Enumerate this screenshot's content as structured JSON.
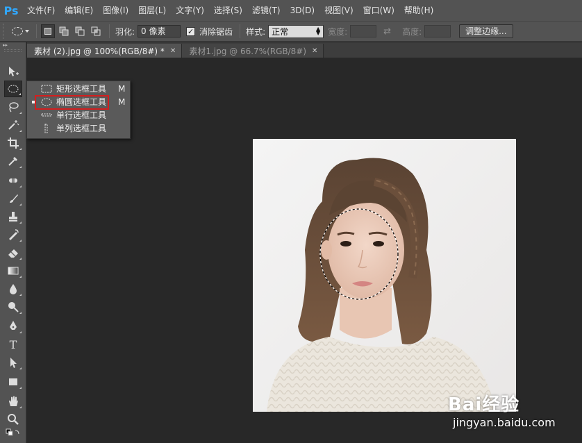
{
  "app": {
    "logo": "Ps"
  },
  "menu": [
    {
      "label": "文件(F)"
    },
    {
      "label": "编辑(E)"
    },
    {
      "label": "图像(I)"
    },
    {
      "label": "图层(L)"
    },
    {
      "label": "文字(Y)"
    },
    {
      "label": "选择(S)"
    },
    {
      "label": "滤镜(T)"
    },
    {
      "label": "3D(D)"
    },
    {
      "label": "视图(V)"
    },
    {
      "label": "窗口(W)"
    },
    {
      "label": "帮助(H)"
    }
  ],
  "options": {
    "tool_icon": "ellipse-marquee-icon",
    "feather_label": "羽化:",
    "feather_value": "0 像素",
    "antialias_label": "消除锯齿",
    "antialias_checked": true,
    "style_label": "样式:",
    "style_value": "正常",
    "width_label": "宽度:",
    "height_label": "高度:",
    "refine_label": "调整边缘..."
  },
  "tabs": [
    {
      "label": "素材 (2).jpg @ 100%(RGB/8#) *",
      "active": true
    },
    {
      "label": "素材1.jpg @ 66.7%(RGB/8#)",
      "active": false
    }
  ],
  "flyout": {
    "items": [
      {
        "label": "矩形选框工具",
        "shortcut": "M",
        "icon": "rect-marquee-icon"
      },
      {
        "label": "椭圆选框工具",
        "shortcut": "M",
        "icon": "ellipse-marquee-icon",
        "current": true
      },
      {
        "label": "单行选框工具",
        "shortcut": "",
        "icon": "single-row-marquee-icon"
      },
      {
        "label": "单列选框工具",
        "shortcut": "",
        "icon": "single-column-marquee-icon"
      }
    ],
    "highlight_color": "#d41e1e"
  },
  "tools": [
    "move-tool",
    "ellipse-marquee-tool",
    "lasso-tool",
    "magic-wand-tool",
    "crop-tool",
    "eyedropper-tool",
    "spot-healing-tool",
    "brush-tool",
    "clone-stamp-tool",
    "history-brush-tool",
    "eraser-tool",
    "gradient-tool",
    "blur-tool",
    "dodge-tool",
    "pen-tool",
    "type-tool",
    "path-selection-tool",
    "shape-tool",
    "hand-tool",
    "zoom-tool"
  ],
  "type_tool_glyph": "T",
  "colors": {
    "accent": "#31a8ff",
    "panel": "#535353",
    "canvas_bg": "#282828"
  },
  "watermark": {
    "brand": "Bai经验",
    "url": "jingyan.baidu.com"
  }
}
